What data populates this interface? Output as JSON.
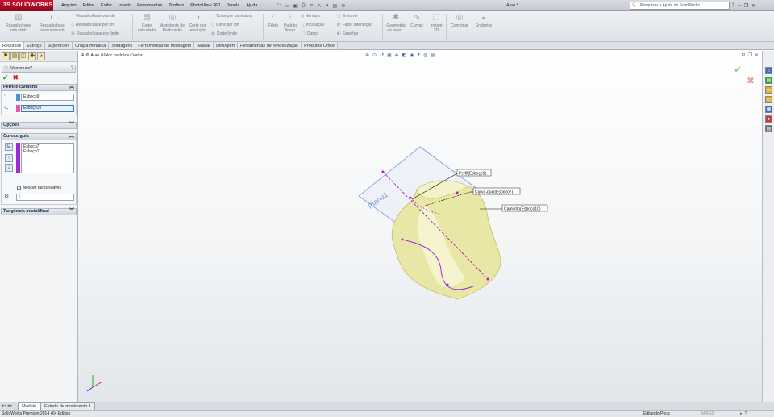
{
  "app": {
    "logo": "SOLIDWORKS",
    "logo_prefix": "3S",
    "document_title": "Aian *"
  },
  "menu": [
    "Arquivo",
    "Editar",
    "Exibir",
    "Inserir",
    "Ferramentas",
    "Toolbox",
    "PhotoView 360",
    "Janela",
    "Ajuda"
  ],
  "search": {
    "placeholder": "Pesquisar a Ajuda do SolidWorks"
  },
  "commands": {
    "extruded_boss": "Ressalto/base extrudado",
    "revolved_boss": "Ressalto/base revolucionado",
    "swept_boss": "Ressalto/base varrido",
    "loft_boss": "Ressalto/base por loft",
    "boundary_boss": "Ressalto/base por limite",
    "extruded_cut": "Corte extrudado",
    "hole_wizard": "Assistente de Perfuração",
    "revolved_cut": "Corte por revolução",
    "swept_cut": "Corte por varredura",
    "loft_cut": "Corte por loft",
    "boundary_cut": "Corte limite",
    "fillet": "Filete",
    "linear_pattern": "Padrão linear",
    "rib": "Nervura",
    "draft": "Inclinação",
    "shell": "Casca",
    "wrap": "Envolver",
    "intersect": "Fazer interseção",
    "mirror": "Espelhar",
    "ref_geometry": "Geometria de refer...",
    "curves": "Curvas",
    "instant3d": "Instant 3D",
    "combine": "Combinar",
    "indent": "Endentar"
  },
  "cmd_tabs": [
    "Recursos",
    "Esboço",
    "Superfícies",
    "Chapa metálica",
    "Soldagens",
    "Ferramentas de moldagem",
    "Avaliar",
    "DimXpert",
    "Ferramentas de renderização",
    "Produtos Office"
  ],
  "tree_flyout": "Aian (Valor padrão<<Valor...",
  "property_manager": {
    "title": "Varredura2",
    "help": "?",
    "groups": {
      "profile_path": "Perfil e caminho",
      "options": "Opções",
      "guide_curves": "Curvas-guia",
      "tangency": "Tangência inicial/final"
    },
    "profile_value": "Esboço9",
    "path_value": "Esboço10",
    "guide_items": [
      "Esboço7",
      "Esboço11"
    ],
    "merge_label": "Mesclar faces suaves",
    "spin_value": "1"
  },
  "model": {
    "plane_label": "Plano1",
    "callouts": [
      "Perfil(Esboço9)",
      "Curva-guia(Esboço7)",
      "Caminho(Esboço10)"
    ]
  },
  "bottom_tabs": [
    "Modelo",
    "Estudo de movimento 1"
  ],
  "status": {
    "edition": "SolidWorks Premium 2014 x64 Edition",
    "mode": "Editando Peça",
    "units": "MMGS"
  },
  "colors": {
    "logo_red": "#c8102e",
    "model_fill": "#e8e7a6",
    "sketch_magenta": "#b01ec8",
    "plane_blue": "#6f8fd6",
    "guide_purple": "#9b2bd9"
  }
}
